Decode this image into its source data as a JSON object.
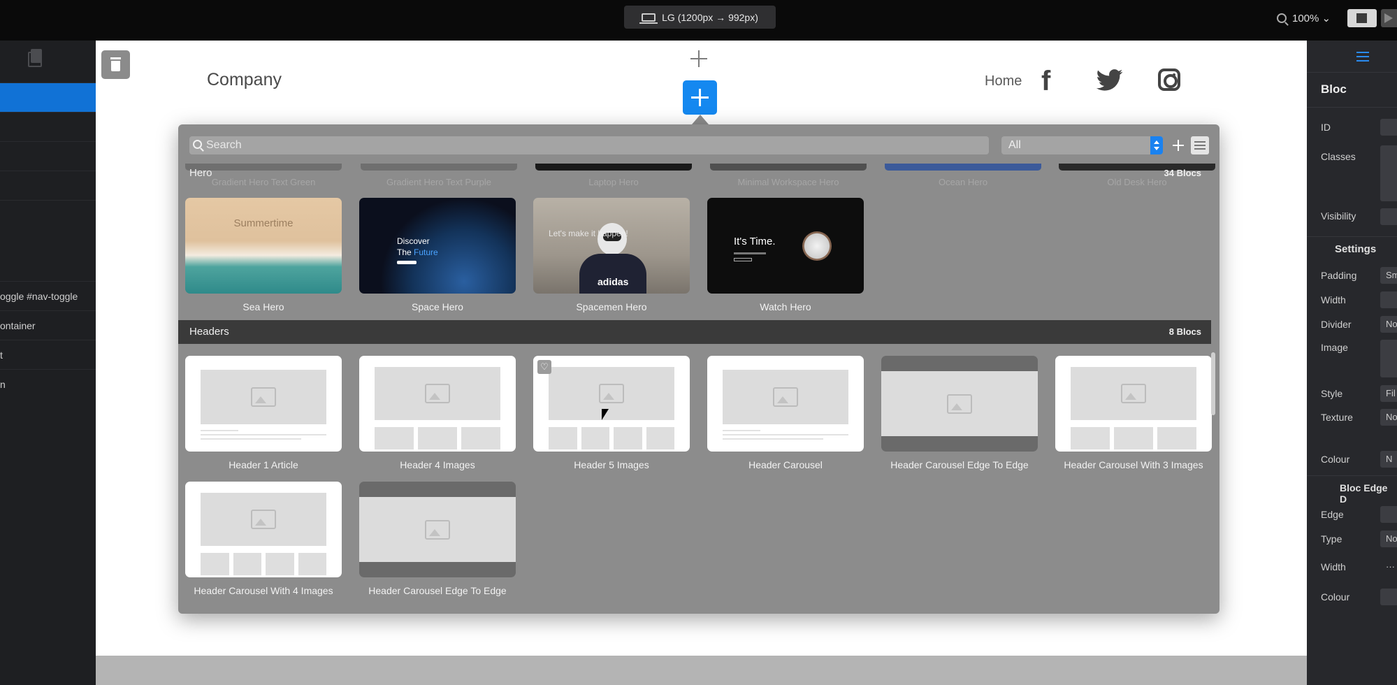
{
  "topbar": {
    "breakpoint_label": "LG (1200px → 992px)",
    "zoom_level": "100% ⌄"
  },
  "left_sidebar": {
    "pages_icon": "pages-icon",
    "layers": [
      {
        "label": "",
        "selected": true
      },
      {
        "label": "",
        "selected": false
      },
      {
        "label": "",
        "selected": false
      },
      {
        "label": "",
        "selected": false
      },
      {
        "label": "",
        "selected": false
      },
      {
        "label": "oggle #nav-toggle",
        "selected": false
      },
      {
        "label": "ontainer",
        "selected": false
      },
      {
        "label": "t",
        "selected": false
      },
      {
        "label": "n",
        "selected": false
      }
    ]
  },
  "canvas": {
    "brand": "Company",
    "nav_home": "Home",
    "social_icons": [
      "facebook-icon",
      "twitter-icon",
      "instagram-icon"
    ]
  },
  "popover": {
    "search_placeholder": "Search",
    "category": "All",
    "ghost_labels": [
      "Gradient Hero Text Green",
      "Gradient Hero Text Purple",
      "Laptop Hero",
      "Minimal Workspace Hero",
      "Ocean Hero",
      "Old Desk Hero"
    ],
    "hero_section": {
      "title": "Hero",
      "count": "34 Blocs",
      "cards": [
        {
          "label": "Sea Hero",
          "thumb_text": "Summertime"
        },
        {
          "label": "Space Hero",
          "thumb_text_1": "Discover",
          "thumb_text_2": "The ",
          "thumb_text_3": "Future"
        },
        {
          "label": "Spacemen Hero",
          "thumb_text": "Let's make it happen!",
          "logo": "adidas"
        },
        {
          "label": "Watch Hero",
          "thumb_text": "It's Time."
        }
      ]
    },
    "headers_section": {
      "title": "Headers",
      "count": "8 Blocs",
      "cards": [
        {
          "label": "Header 1 Article"
        },
        {
          "label": "Header 4 Images"
        },
        {
          "label": "Header 5 Images"
        },
        {
          "label": "Header Carousel"
        },
        {
          "label": "Header Carousel Edge To Edge"
        },
        {
          "label": "Header Carousel With 3 Images"
        },
        {
          "label": "Header Carousel With 4 Images"
        },
        {
          "label": "Header Carousel Edge To Edge"
        }
      ]
    }
  },
  "right_panel": {
    "title": "Bloc",
    "id_label": "ID",
    "classes_label": "Classes",
    "visibility_label": "Visibility",
    "settings_title": "Settings",
    "padding_label": "Padding",
    "padding_value": "Sm",
    "width_label": "Width",
    "divider_label": "Divider",
    "divider_value": "No",
    "image_label": "Image",
    "style_label": "Style",
    "style_value": "Fil",
    "texture_label": "Texture",
    "texture_value": "No",
    "colour_label": "Colour",
    "colour_value": "N",
    "edge_section_title": "Bloc Edge D",
    "edge_label": "Edge",
    "type_label": "Type",
    "type_value": "No",
    "edge_width_label": "Width",
    "edge_width_value": "···",
    "edge_colour_label": "Colour"
  }
}
